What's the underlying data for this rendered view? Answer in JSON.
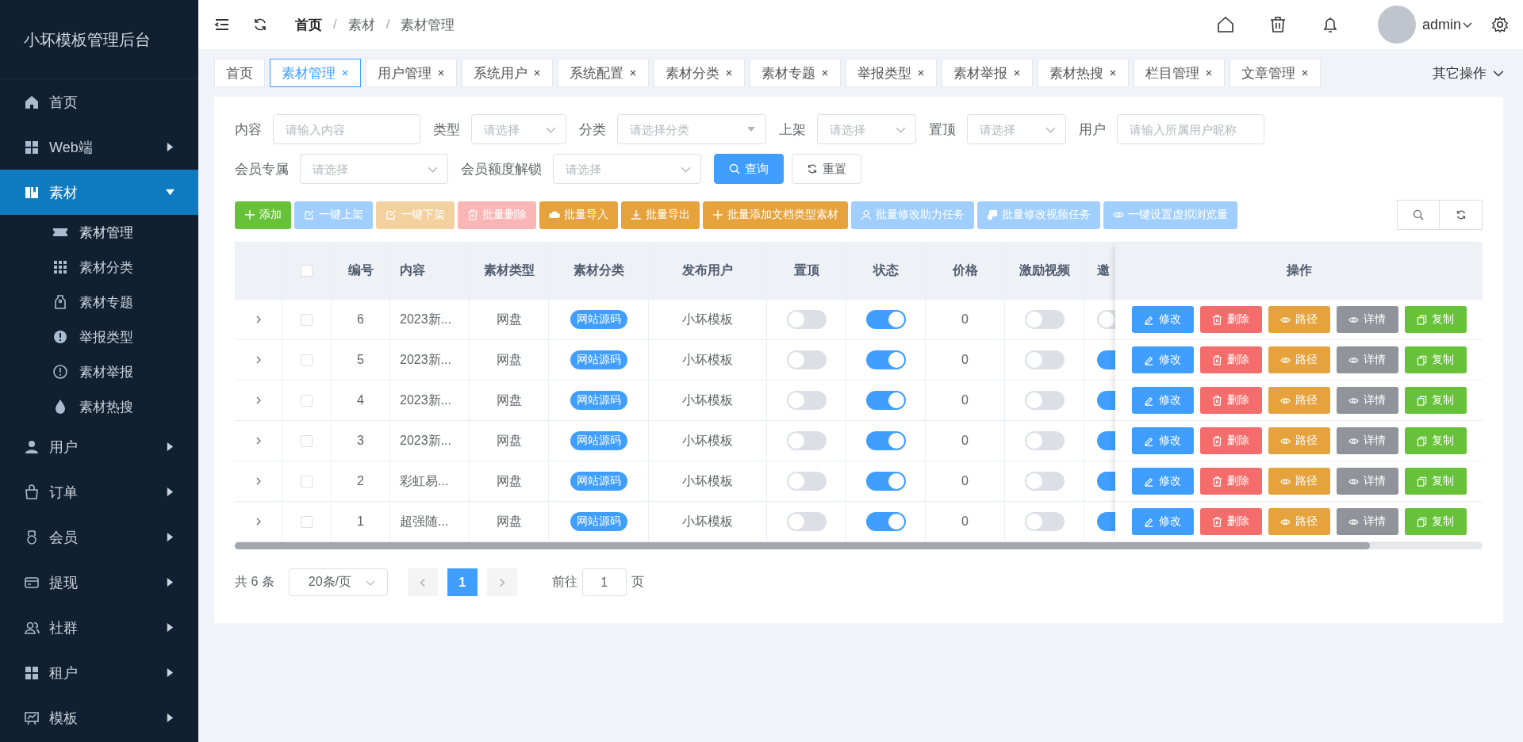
{
  "sidebar": {
    "title": "小坏模板管理后台",
    "items": [
      {
        "label": "首页",
        "kind": "link",
        "selected": false
      },
      {
        "label": "Web端",
        "kind": "group",
        "selected": false,
        "expanded": false
      },
      {
        "label": "素材",
        "kind": "group",
        "selected": true,
        "expanded": true,
        "children": [
          {
            "label": "素材管理",
            "selected": true
          },
          {
            "label": "素材分类",
            "selected": false
          },
          {
            "label": "素材专题",
            "selected": false
          },
          {
            "label": "举报类型",
            "selected": false
          },
          {
            "label": "素材举报",
            "selected": false
          },
          {
            "label": "素材热搜",
            "selected": false
          }
        ]
      },
      {
        "label": "用户",
        "kind": "group",
        "selected": false,
        "expanded": false
      },
      {
        "label": "订单",
        "kind": "group",
        "selected": false,
        "expanded": false
      },
      {
        "label": "会员",
        "kind": "group",
        "selected": false,
        "expanded": false
      },
      {
        "label": "提现",
        "kind": "group",
        "selected": false,
        "expanded": false
      },
      {
        "label": "社群",
        "kind": "group",
        "selected": false,
        "expanded": false
      },
      {
        "label": "租户",
        "kind": "group",
        "selected": false,
        "expanded": false
      },
      {
        "label": "模板",
        "kind": "group",
        "selected": false,
        "expanded": false
      }
    ]
  },
  "header": {
    "breadcrumb": [
      "首页",
      "素材",
      "素材管理"
    ],
    "breadcrumb_separators": [
      "/",
      "/"
    ],
    "user": "admin"
  },
  "tabs": [
    {
      "label": "首页",
      "selected": false,
      "closable": false
    },
    {
      "label": "素材管理",
      "selected": true,
      "closable": true
    },
    {
      "label": "用户管理",
      "selected": false,
      "closable": true
    },
    {
      "label": "系统用户",
      "selected": false,
      "closable": true
    },
    {
      "label": "系统配置",
      "selected": false,
      "closable": true
    },
    {
      "label": "素材分类",
      "selected": false,
      "closable": true
    },
    {
      "label": "素材专题",
      "selected": false,
      "closable": true
    },
    {
      "label": "举报类型",
      "selected": false,
      "closable": true
    },
    {
      "label": "素材举报",
      "selected": false,
      "closable": true
    },
    {
      "label": "素材热搜",
      "selected": false,
      "closable": true
    },
    {
      "label": "栏目管理",
      "selected": false,
      "closable": true
    },
    {
      "label": "文章管理",
      "selected": false,
      "closable": true
    }
  ],
  "tab_menu": "其它操作",
  "filters": [
    {
      "label": "内容",
      "kind": "input",
      "placeholder": "请输入内容"
    },
    {
      "label": "类型",
      "kind": "select",
      "placeholder": "请选择"
    },
    {
      "label": "分类",
      "kind": "tree-select",
      "placeholder": "请选择分类"
    },
    {
      "label": "上架",
      "kind": "select",
      "placeholder": "请选择"
    },
    {
      "label": "置顶",
      "kind": "select",
      "placeholder": "请选择"
    },
    {
      "label": "用户",
      "kind": "input",
      "placeholder": "请输入所属用户昵称"
    },
    {
      "label": "会员专属",
      "kind": "select",
      "placeholder": "请选择"
    },
    {
      "label": "会员额度解锁",
      "kind": "select",
      "placeholder": "请选择"
    }
  ],
  "search_buttons": [
    "查询",
    "重置"
  ],
  "toolbar": [
    {
      "label": "添加",
      "color": "#67c23a"
    },
    {
      "label": "一键上架",
      "color": "#a0cfff"
    },
    {
      "label": "一键下架",
      "color": "#f3d19e"
    },
    {
      "label": "批量删除",
      "color": "#fab6b6"
    },
    {
      "label": "批量导入",
      "color": "#e6a23c"
    },
    {
      "label": "批量导出",
      "color": "#e6a23c"
    },
    {
      "label": "批量添加文档类型素材",
      "color": "#e6a23c"
    },
    {
      "label": "批量修改助力任务",
      "color": "#a0cfff"
    },
    {
      "label": "批量修改视频任务",
      "color": "#a0cfff"
    },
    {
      "label": "一键设置虚拟浏览量",
      "color": "#a0cfff"
    }
  ],
  "table": {
    "header_checked": false,
    "columns": [
      "编号",
      "内容",
      "素材类型",
      "素材分类",
      "发布用户",
      "置顶",
      "状态",
      "价格",
      "激励视频",
      "邀"
    ],
    "action_column": "操作",
    "rows": [
      {
        "expanded": false,
        "checked": false,
        "id": "6",
        "content": "2023新...",
        "type": "网盘",
        "category": "网站源码",
        "user": "小坏模板",
        "top": false,
        "status": true,
        "price": "0",
        "video": false,
        "column_12": false,
        "actions": [
          "修改",
          "删除",
          "路径",
          "详情",
          "复制"
        ]
      },
      {
        "expanded": false,
        "checked": false,
        "id": "5",
        "content": "2023新...",
        "type": "网盘",
        "category": "网站源码",
        "user": "小坏模板",
        "top": false,
        "status": true,
        "price": "0",
        "video": false,
        "column_12": true,
        "actions": [
          "修改",
          "删除",
          "路径",
          "详情",
          "复制"
        ]
      },
      {
        "expanded": false,
        "checked": false,
        "id": "4",
        "content": "2023新...",
        "type": "网盘",
        "category": "网站源码",
        "user": "小坏模板",
        "top": false,
        "status": true,
        "price": "0",
        "video": false,
        "column_12": true,
        "actions": [
          "修改",
          "删除",
          "路径",
          "详情",
          "复制"
        ]
      },
      {
        "expanded": false,
        "checked": false,
        "id": "3",
        "content": "2023新...",
        "type": "网盘",
        "category": "网站源码",
        "user": "小坏模板",
        "top": false,
        "status": true,
        "price": "0",
        "video": false,
        "column_12": true,
        "actions": [
          "修改",
          "删除",
          "路径",
          "详情",
          "复制"
        ]
      },
      {
        "expanded": false,
        "checked": false,
        "id": "2",
        "content": "彩虹易...",
        "type": "网盘",
        "category": "网站源码",
        "user": "小坏模板",
        "top": false,
        "status": true,
        "price": "0",
        "video": false,
        "column_12": true,
        "actions": [
          "修改",
          "删除",
          "路径",
          "详情",
          "复制"
        ]
      },
      {
        "expanded": false,
        "checked": false,
        "id": "1",
        "content": "超强随...",
        "type": "网盘",
        "category": "网站源码",
        "user": "小坏模板",
        "top": false,
        "status": true,
        "price": "0",
        "video": false,
        "column_12": true,
        "actions": [
          "修改",
          "删除",
          "路径",
          "详情",
          "复制"
        ]
      }
    ]
  },
  "pagination": {
    "total": "共 6 条",
    "page_size": "20条/页",
    "pages": [
      {
        "label": "1",
        "selected": true
      }
    ],
    "goto": "前往",
    "goto_value": "1",
    "page_suffix": "页"
  }
}
